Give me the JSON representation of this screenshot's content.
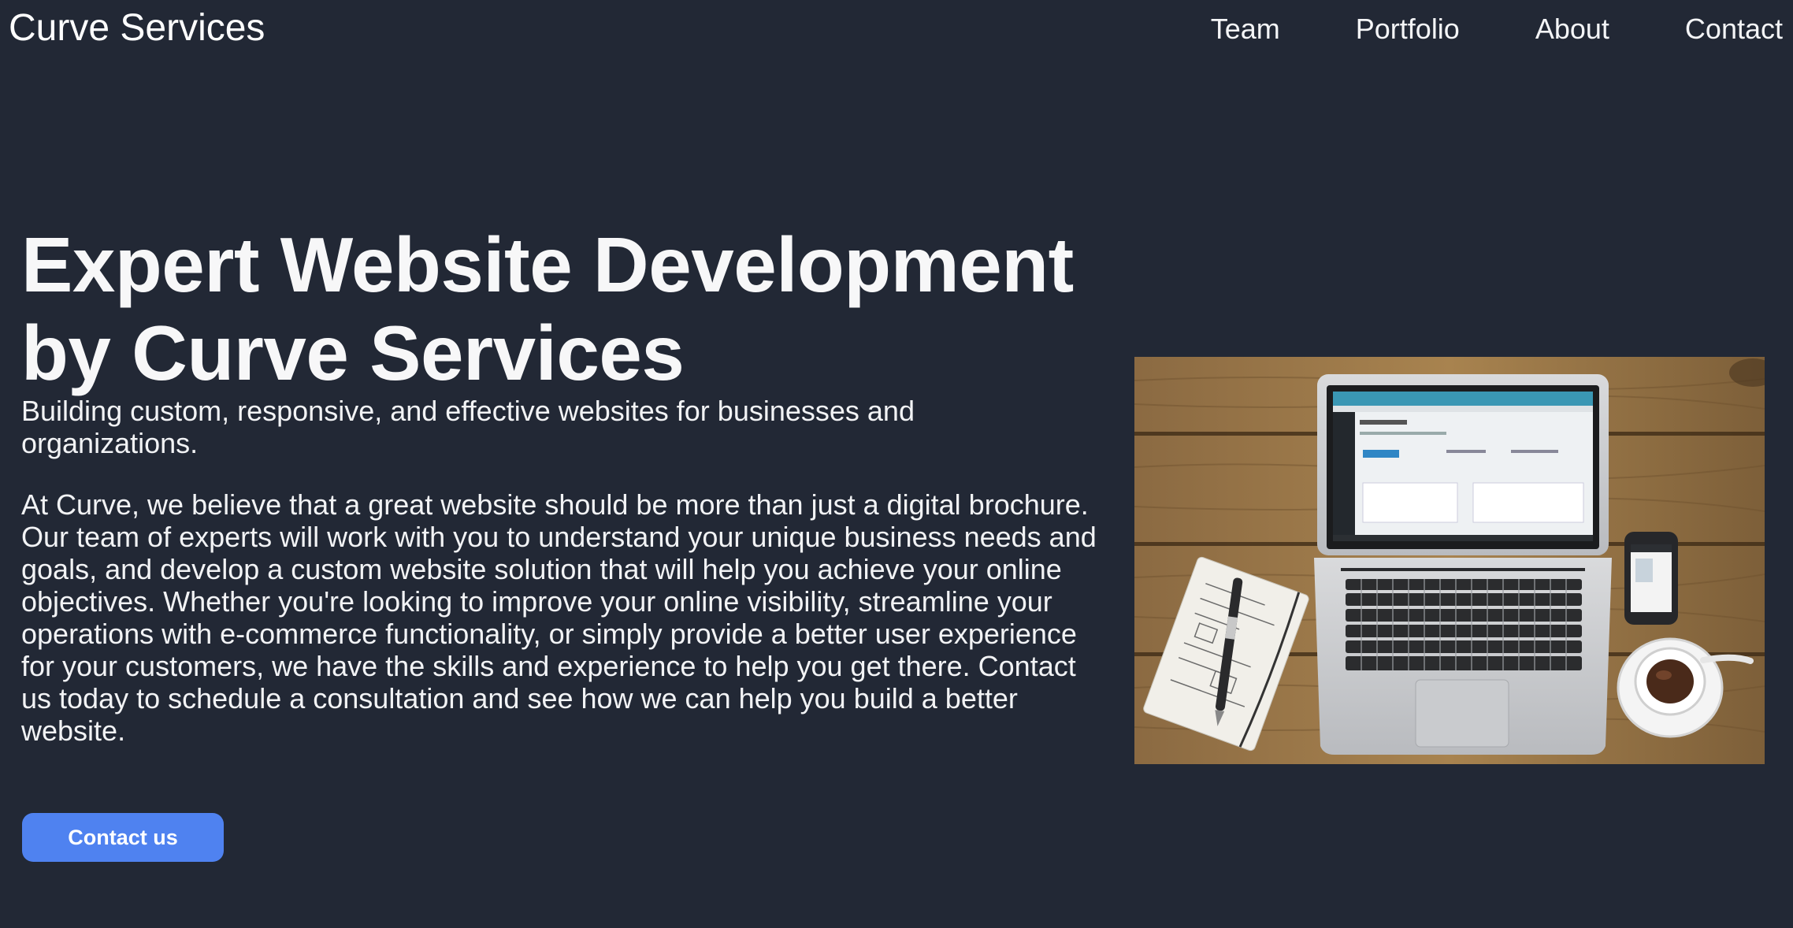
{
  "header": {
    "brand": "Curve Services",
    "nav": [
      "Team",
      "Portfolio",
      "About",
      "Contact"
    ]
  },
  "hero": {
    "title": "Expert Website Development by Curve Services",
    "subtitle": "Building custom, responsive, and effective websites for businesses and organizations.",
    "body": "At Curve, we believe that a great website should be more than just a digital brochure. Our team of experts will work with you to understand your unique business needs and goals, and develop a custom website solution that will help you achieve your online objectives. Whether you're looking to improve your online visibility, streamline your operations with e-commerce functionality, or simply provide a better user experience for your customers, we have the skills and experience to help you get there. Contact us today to schedule a consultation and see how we can help you build a better website.",
    "cta_label": "Contact us"
  },
  "colors": {
    "background": "#222835",
    "text": "#f2f3f5",
    "accent": "#4f82f0"
  },
  "image": {
    "subject": "laptop-on-wooden-desk-photo"
  }
}
